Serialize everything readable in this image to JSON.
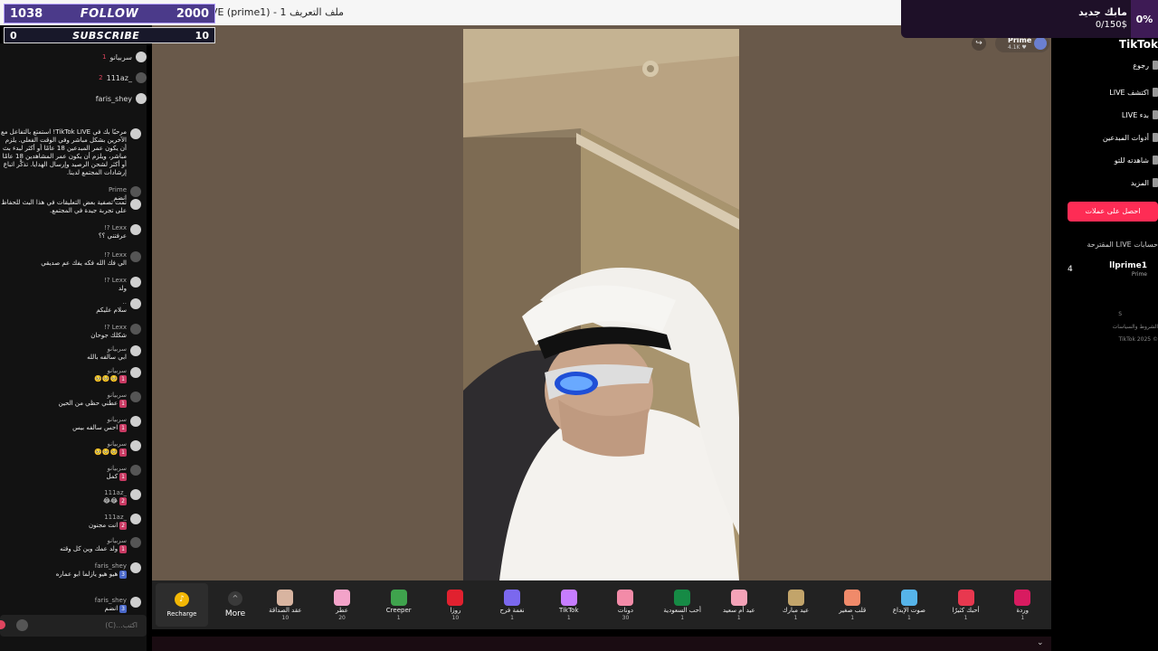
{
  "window": {
    "title": "ملف التعريف 1 - TikTok LIVE   (prime1) - بث مباشر"
  },
  "stats": {
    "followers_count": "1038",
    "follow_label": "FOLLOW",
    "follow_goal": "2000",
    "subs_count": "0",
    "subscribe_label": "SUBSCRIBE",
    "subs_goal": "10"
  },
  "goal": {
    "title": "مابك جديد",
    "value": "0/150$",
    "percent": "0%"
  },
  "chat": {
    "top_viewers": [
      {
        "rank": "1",
        "name": "سربيانو"
      },
      {
        "rank": "2",
        "name": "_111az"
      },
      {
        "rank": "",
        "name": "faris_shey"
      }
    ],
    "messages": [
      {
        "user": "",
        "text": "مرحبًا بك في TikTok LIVE! استمتع بالتفاعل مع الآخرين بشكل مباشر وفي الوقت الفعلي. يلزم أن يكون عمر المبدعين 18 عامًا أو أكثر لبدء بث مباشر، ويلزم أن يكون عمر المشاهدين 18 عامًا أو أكثر لشحن الرصيد وإرسال الهدايا. تذكَّر اتباع إرشادات المجتمع لدينا."
      },
      {
        "user": "Prime",
        "text": "انضم"
      },
      {
        "user": "",
        "text": "تمت تصفية بعض التعليقات في هذا البث للحفاظ على تجربة جيدة في المجتمع."
      },
      {
        "user": "Lexx ?!",
        "text": "عرفتني ؟؟"
      },
      {
        "user": "Lexx ?!",
        "text": "الي فك الله فكه يفك عم صديقي"
      },
      {
        "user": "Lexx ?!",
        "text": "ولد"
      },
      {
        "user": "..",
        "text": "سلام عليكم"
      },
      {
        "user": "Lexx ?!",
        "text": "شكلك جوحان"
      },
      {
        "user": "سربيانو",
        "text": "ابي سالفه بالله"
      },
      {
        "user": "سربيانو",
        "text": "🥺🥺🥺",
        "level": "1"
      },
      {
        "user": "سربيانو",
        "text": "عطني حظي من الحين",
        "level": "1"
      },
      {
        "user": "سربيانو",
        "text": "احس سالفه بيس",
        "level": "1"
      },
      {
        "user": "سربيانو",
        "text": "🥺🥺🥺",
        "level": "1"
      },
      {
        "user": "سربيانو",
        "text": "كمل",
        "level": "1"
      },
      {
        "user": "_111az",
        "text": "😂😂",
        "level": "2"
      },
      {
        "user": "_111az",
        "text": "انت مجنون",
        "level": "2"
      },
      {
        "user": "سربيانو",
        "text": "ولد عمك وين كل وقته",
        "level": "1"
      },
      {
        "user": "faris_shey",
        "text": "هيو هيو يازلما ابو عماره",
        "level": "3"
      },
      {
        "user": "faris_shey",
        "text": "انضم",
        "level": "3"
      }
    ],
    "input_placeholder": "اكتب...(C)"
  },
  "stage": {
    "share_icon": "↪",
    "host_name": "Prime",
    "host_likes": "4.1K ♥"
  },
  "gifts": {
    "recharge_label": "Recharge",
    "more_label": "More",
    "items": [
      {
        "name": "عقد الصداقة",
        "cost": "10",
        "color": "#d8b4a0"
      },
      {
        "name": "عطر",
        "cost": "20",
        "color": "#f3a3c9"
      },
      {
        "name": "Creeper",
        "cost": "1",
        "color": "#3fa34d"
      },
      {
        "name": "روزا",
        "cost": "10",
        "color": "#e1212f"
      },
      {
        "name": "نغمة فرح",
        "cost": "1",
        "color": "#7b68ee"
      },
      {
        "name": "TikTok",
        "cost": "1",
        "color": "#c77dff"
      },
      {
        "name": "دونات",
        "cost": "30",
        "color": "#f38ba8"
      },
      {
        "name": "أحب السعودية",
        "cost": "1",
        "color": "#168a45"
      },
      {
        "name": "عيد أم سعيد",
        "cost": "1",
        "color": "#f4a3b8"
      },
      {
        "name": "عيد مبارك",
        "cost": "1",
        "color": "#c2a46a"
      },
      {
        "name": "قلب صغير",
        "cost": "1",
        "color": "#f08a6a"
      },
      {
        "name": "صوت الإبداع",
        "cost": "1",
        "color": "#56b4e9"
      },
      {
        "name": "أحبك كثيرًا",
        "cost": "1",
        "color": "#e8384f"
      },
      {
        "name": "وردة",
        "cost": "1",
        "color": "#d81b60"
      }
    ]
  },
  "sidebar": {
    "logo": "TikTok",
    "nav": [
      "رجوع",
      "اكتشف LIVE",
      "بدء LIVE",
      "أدوات المبدعين",
      "شاهدته للتو",
      "المزيد"
    ],
    "coin_button": "احصل على عملات",
    "suggested_title": "حسابات LIVE المقترحة",
    "account": {
      "name": "llprime1",
      "sub": "Prime",
      "count": "4"
    },
    "footer": [
      "S",
      "الشروط والسياسات",
      "TikTok 2025 ©"
    ]
  }
}
